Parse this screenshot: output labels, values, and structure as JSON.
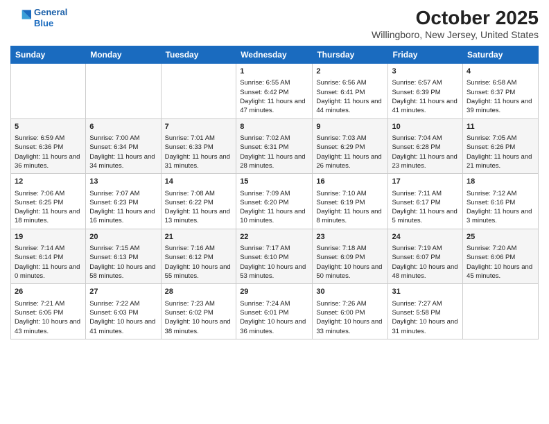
{
  "header": {
    "logo_line1": "General",
    "logo_line2": "Blue",
    "title": "October 2025",
    "subtitle": "Willingboro, New Jersey, United States"
  },
  "weekdays": [
    "Sunday",
    "Monday",
    "Tuesday",
    "Wednesday",
    "Thursday",
    "Friday",
    "Saturday"
  ],
  "weeks": [
    [
      {
        "day": "",
        "sunrise": "",
        "sunset": "",
        "daylight": ""
      },
      {
        "day": "",
        "sunrise": "",
        "sunset": "",
        "daylight": ""
      },
      {
        "day": "",
        "sunrise": "",
        "sunset": "",
        "daylight": ""
      },
      {
        "day": "1",
        "sunrise": "Sunrise: 6:55 AM",
        "sunset": "Sunset: 6:42 PM",
        "daylight": "Daylight: 11 hours and 47 minutes."
      },
      {
        "day": "2",
        "sunrise": "Sunrise: 6:56 AM",
        "sunset": "Sunset: 6:41 PM",
        "daylight": "Daylight: 11 hours and 44 minutes."
      },
      {
        "day": "3",
        "sunrise": "Sunrise: 6:57 AM",
        "sunset": "Sunset: 6:39 PM",
        "daylight": "Daylight: 11 hours and 41 minutes."
      },
      {
        "day": "4",
        "sunrise": "Sunrise: 6:58 AM",
        "sunset": "Sunset: 6:37 PM",
        "daylight": "Daylight: 11 hours and 39 minutes."
      }
    ],
    [
      {
        "day": "5",
        "sunrise": "Sunrise: 6:59 AM",
        "sunset": "Sunset: 6:36 PM",
        "daylight": "Daylight: 11 hours and 36 minutes."
      },
      {
        "day": "6",
        "sunrise": "Sunrise: 7:00 AM",
        "sunset": "Sunset: 6:34 PM",
        "daylight": "Daylight: 11 hours and 34 minutes."
      },
      {
        "day": "7",
        "sunrise": "Sunrise: 7:01 AM",
        "sunset": "Sunset: 6:33 PM",
        "daylight": "Daylight: 11 hours and 31 minutes."
      },
      {
        "day": "8",
        "sunrise": "Sunrise: 7:02 AM",
        "sunset": "Sunset: 6:31 PM",
        "daylight": "Daylight: 11 hours and 28 minutes."
      },
      {
        "day": "9",
        "sunrise": "Sunrise: 7:03 AM",
        "sunset": "Sunset: 6:29 PM",
        "daylight": "Daylight: 11 hours and 26 minutes."
      },
      {
        "day": "10",
        "sunrise": "Sunrise: 7:04 AM",
        "sunset": "Sunset: 6:28 PM",
        "daylight": "Daylight: 11 hours and 23 minutes."
      },
      {
        "day": "11",
        "sunrise": "Sunrise: 7:05 AM",
        "sunset": "Sunset: 6:26 PM",
        "daylight": "Daylight: 11 hours and 21 minutes."
      }
    ],
    [
      {
        "day": "12",
        "sunrise": "Sunrise: 7:06 AM",
        "sunset": "Sunset: 6:25 PM",
        "daylight": "Daylight: 11 hours and 18 minutes."
      },
      {
        "day": "13",
        "sunrise": "Sunrise: 7:07 AM",
        "sunset": "Sunset: 6:23 PM",
        "daylight": "Daylight: 11 hours and 16 minutes."
      },
      {
        "day": "14",
        "sunrise": "Sunrise: 7:08 AM",
        "sunset": "Sunset: 6:22 PM",
        "daylight": "Daylight: 11 hours and 13 minutes."
      },
      {
        "day": "15",
        "sunrise": "Sunrise: 7:09 AM",
        "sunset": "Sunset: 6:20 PM",
        "daylight": "Daylight: 11 hours and 10 minutes."
      },
      {
        "day": "16",
        "sunrise": "Sunrise: 7:10 AM",
        "sunset": "Sunset: 6:19 PM",
        "daylight": "Daylight: 11 hours and 8 minutes."
      },
      {
        "day": "17",
        "sunrise": "Sunrise: 7:11 AM",
        "sunset": "Sunset: 6:17 PM",
        "daylight": "Daylight: 11 hours and 5 minutes."
      },
      {
        "day": "18",
        "sunrise": "Sunrise: 7:12 AM",
        "sunset": "Sunset: 6:16 PM",
        "daylight": "Daylight: 11 hours and 3 minutes."
      }
    ],
    [
      {
        "day": "19",
        "sunrise": "Sunrise: 7:14 AM",
        "sunset": "Sunset: 6:14 PM",
        "daylight": "Daylight: 11 hours and 0 minutes."
      },
      {
        "day": "20",
        "sunrise": "Sunrise: 7:15 AM",
        "sunset": "Sunset: 6:13 PM",
        "daylight": "Daylight: 10 hours and 58 minutes."
      },
      {
        "day": "21",
        "sunrise": "Sunrise: 7:16 AM",
        "sunset": "Sunset: 6:12 PM",
        "daylight": "Daylight: 10 hours and 55 minutes."
      },
      {
        "day": "22",
        "sunrise": "Sunrise: 7:17 AM",
        "sunset": "Sunset: 6:10 PM",
        "daylight": "Daylight: 10 hours and 53 minutes."
      },
      {
        "day": "23",
        "sunrise": "Sunrise: 7:18 AM",
        "sunset": "Sunset: 6:09 PM",
        "daylight": "Daylight: 10 hours and 50 minutes."
      },
      {
        "day": "24",
        "sunrise": "Sunrise: 7:19 AM",
        "sunset": "Sunset: 6:07 PM",
        "daylight": "Daylight: 10 hours and 48 minutes."
      },
      {
        "day": "25",
        "sunrise": "Sunrise: 7:20 AM",
        "sunset": "Sunset: 6:06 PM",
        "daylight": "Daylight: 10 hours and 45 minutes."
      }
    ],
    [
      {
        "day": "26",
        "sunrise": "Sunrise: 7:21 AM",
        "sunset": "Sunset: 6:05 PM",
        "daylight": "Daylight: 10 hours and 43 minutes."
      },
      {
        "day": "27",
        "sunrise": "Sunrise: 7:22 AM",
        "sunset": "Sunset: 6:03 PM",
        "daylight": "Daylight: 10 hours and 41 minutes."
      },
      {
        "day": "28",
        "sunrise": "Sunrise: 7:23 AM",
        "sunset": "Sunset: 6:02 PM",
        "daylight": "Daylight: 10 hours and 38 minutes."
      },
      {
        "day": "29",
        "sunrise": "Sunrise: 7:24 AM",
        "sunset": "Sunset: 6:01 PM",
        "daylight": "Daylight: 10 hours and 36 minutes."
      },
      {
        "day": "30",
        "sunrise": "Sunrise: 7:26 AM",
        "sunset": "Sunset: 6:00 PM",
        "daylight": "Daylight: 10 hours and 33 minutes."
      },
      {
        "day": "31",
        "sunrise": "Sunrise: 7:27 AM",
        "sunset": "Sunset: 5:58 PM",
        "daylight": "Daylight: 10 hours and 31 minutes."
      },
      {
        "day": "",
        "sunrise": "",
        "sunset": "",
        "daylight": ""
      }
    ]
  ]
}
